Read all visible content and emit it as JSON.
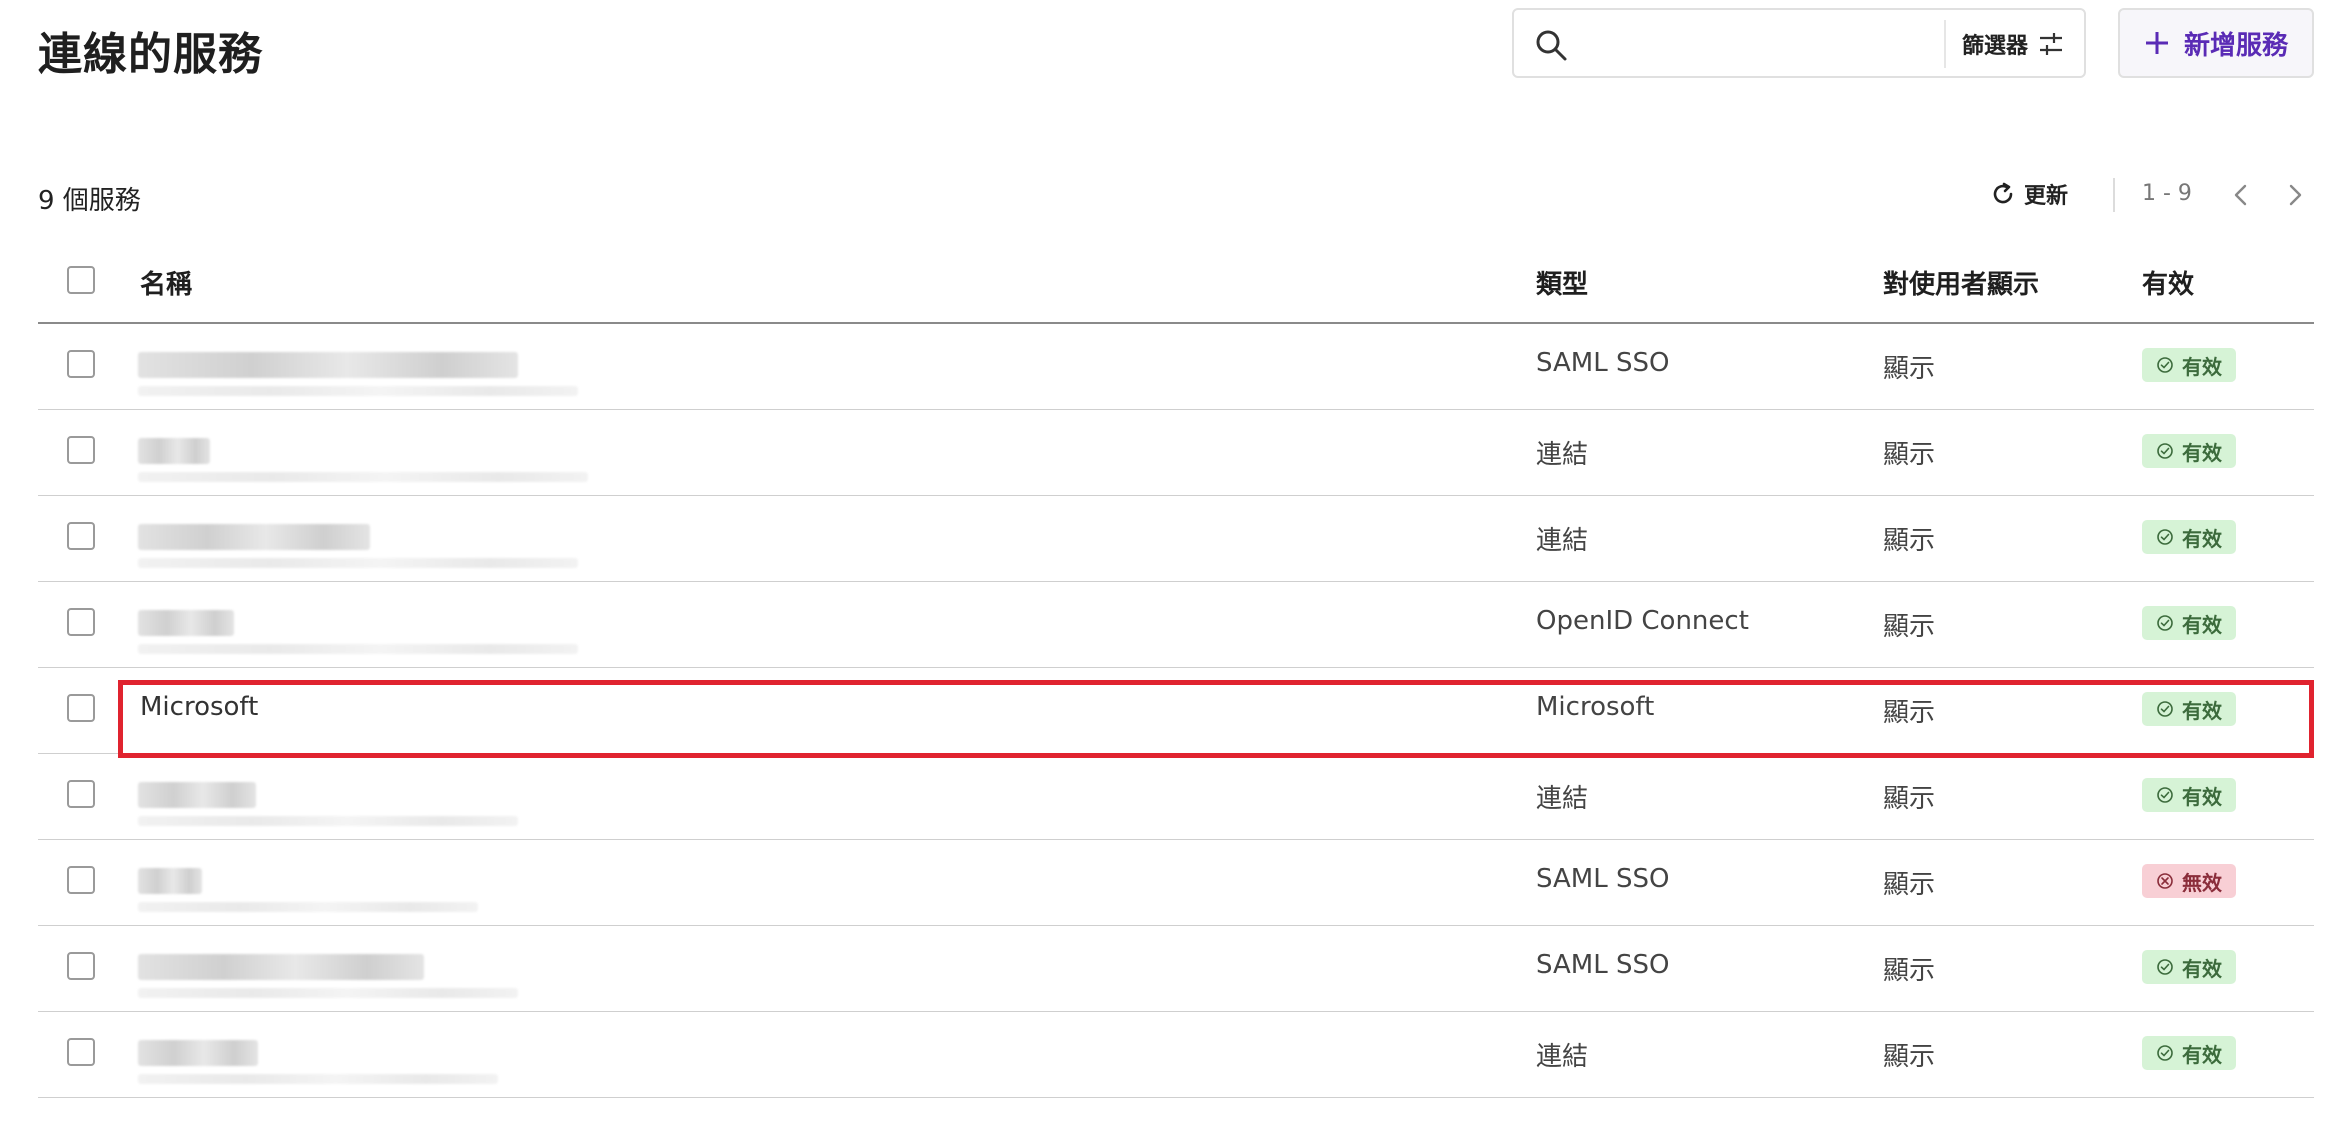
{
  "header": {
    "title": "連線的服務",
    "filter_label": "篩選器",
    "add_label": "新增服務",
    "search_placeholder": ""
  },
  "toolbar": {
    "count_label": "9 個服務",
    "refresh_label": "更新",
    "page_range": "1 - 9"
  },
  "columns": {
    "name": "名稱",
    "type": "類型",
    "visibility": "對使用者顯示",
    "status": "有效"
  },
  "rows": [
    {
      "name": "",
      "type": "SAML SSO",
      "visibility": "顯示",
      "status": "有效",
      "status_kind": "ok"
    },
    {
      "name": "",
      "type": "連結",
      "visibility": "顯示",
      "status": "有效",
      "status_kind": "ok"
    },
    {
      "name": "",
      "type": "連結",
      "visibility": "顯示",
      "status": "有效",
      "status_kind": "ok"
    },
    {
      "name": "",
      "type": "OpenID Connect",
      "visibility": "顯示",
      "status": "有效",
      "status_kind": "ok"
    },
    {
      "name": "Microsoft",
      "type": "Microsoft",
      "visibility": "顯示",
      "status": "有效",
      "status_kind": "ok"
    },
    {
      "name": "",
      "type": "連結",
      "visibility": "顯示",
      "status": "有效",
      "status_kind": "ok"
    },
    {
      "name": "",
      "type": "SAML SSO",
      "visibility": "顯示",
      "status": "無效",
      "status_kind": "bad"
    },
    {
      "name": "",
      "type": "SAML SSO",
      "visibility": "顯示",
      "status": "有效",
      "status_kind": "ok"
    },
    {
      "name": "",
      "type": "連結",
      "visibility": "顯示",
      "status": "有效",
      "status_kind": "ok"
    }
  ],
  "colors": {
    "accent": "#5a2bb5",
    "highlight": "#e0232f",
    "status_ok_bg": "#d6f3d6",
    "status_bad_bg": "#f8cfd5"
  }
}
